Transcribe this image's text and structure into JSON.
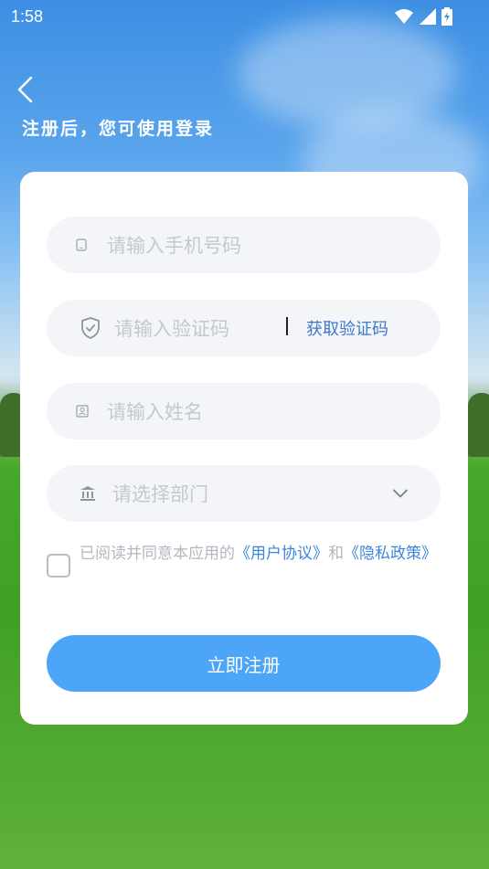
{
  "status_bar": {
    "time": "1:58",
    "icons": [
      "wifi-icon",
      "signal-icon",
      "battery-charging-icon"
    ]
  },
  "header": {
    "back_icon": "chevron-left-icon",
    "hint": "注册后，您可使用登录"
  },
  "form": {
    "phone": {
      "icon": "phone-icon",
      "placeholder": "请输入手机号码"
    },
    "code": {
      "icon": "shield-check-icon",
      "placeholder": "请输入验证码",
      "button": "获取验证码"
    },
    "name": {
      "icon": "id-card-icon",
      "placeholder": "请输入姓名"
    },
    "department": {
      "icon": "bank-icon",
      "placeholder": "请选择部门",
      "dropdown_icon": "chevron-down-icon"
    }
  },
  "agreement": {
    "prefix": "已阅读并同意本应用的",
    "user_agreement": "《用户协议》",
    "conjunction": "和",
    "privacy_policy": "《隐私政策》",
    "checked": false
  },
  "submit": {
    "label": "立即注册"
  },
  "colors": {
    "accent": "#4da5f7",
    "link": "#3b86dc",
    "field_bg": "#f3f5f9",
    "placeholder": "#c4c8d0"
  }
}
